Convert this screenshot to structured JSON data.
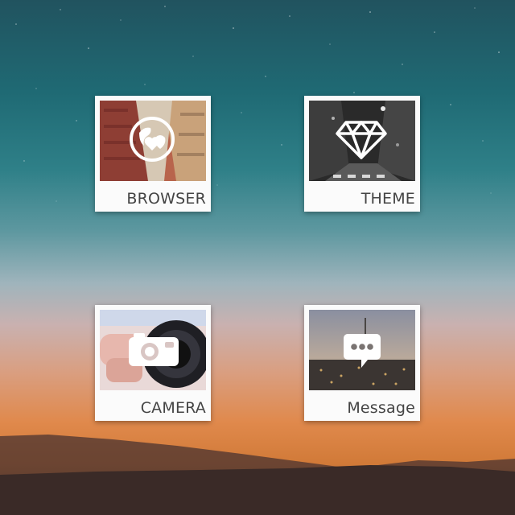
{
  "apps": [
    {
      "label": "BROWSER",
      "icon": "globe-heart-icon"
    },
    {
      "label": "THEME",
      "icon": "diamond-icon"
    },
    {
      "label": "CAMERA",
      "icon": "camera-icon"
    },
    {
      "label": "Message",
      "icon": "chat-bubble-icon"
    }
  ],
  "colors": {
    "card_background": "#fbfbfb",
    "label_text": "#444444",
    "icon": "#ffffff"
  }
}
